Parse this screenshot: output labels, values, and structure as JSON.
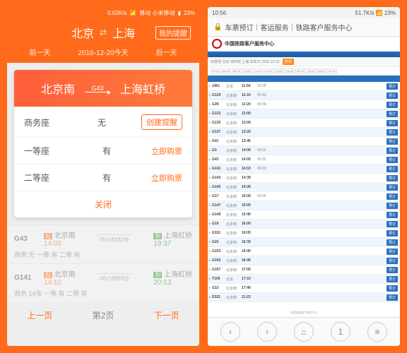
{
  "left": {
    "status": {
      "speed": "0.02K/s",
      "carrier": "移动  小米移动",
      "battery": "23%"
    },
    "header": {
      "from": "北京",
      "to": "上海",
      "remind": "我的提醒",
      "prev": "前一天",
      "date": "2016-12-20今天",
      "next": "后一天"
    },
    "modal": {
      "from": "北京南",
      "train": "G43",
      "to": "上海虹桥",
      "seats": [
        {
          "name": "商务座",
          "status": "无",
          "action": "创建提醒",
          "boxed": true
        },
        {
          "name": "一等座",
          "status": "有",
          "action": "立即购票",
          "boxed": false
        },
        {
          "name": "二等座",
          "status": "有",
          "action": "立即购票",
          "boxed": false
        }
      ],
      "close": "关闭"
    },
    "list": [
      {
        "no": "G43",
        "from": "北京南",
        "to": "上海虹桥",
        "dur": "05小时32分",
        "dep": "14:05",
        "arr": "19:37",
        "sum": "商务:无  一等:有  二等:有"
      },
      {
        "no": "G141",
        "from": "北京南",
        "to": "上海虹桥",
        "dur": "06小时03分",
        "dep": "14:10",
        "arr": "20:13",
        "sum": "商务:14张  一等:有  二等:有"
      }
    ],
    "pager": {
      "prev": "上一页",
      "cur": "第2页",
      "next": "下一页"
    },
    "tags": {
      "dep": "起",
      "arr": "到"
    }
  },
  "right": {
    "status": {
      "time": "10:56",
      "speed": "51.7K/s",
      "battery": "23%"
    },
    "url": "车票预订｜客运服务｜铁路客户服务中心",
    "brand": "中国铁路客户服务中心",
    "search": {
      "label": "出发地 北京  目的地 上海  出发日 2016-12-20",
      "btn": "查询"
    },
    "filter_chips": [
      "00:00",
      "06:00",
      "08:00",
      "10:00",
      "11:00",
      "12:00",
      "13:00",
      "15:00",
      "16:00",
      "18:00",
      "20:00",
      "22:00"
    ],
    "rows": [
      {
        "no": "1461",
        "st": "北京",
        "t1": "11:54",
        "dur": "19:28"
      },
      {
        "no": "G129",
        "st": "北京南",
        "t1": "12:10",
        "dur": "05:43"
      },
      {
        "no": "G39",
        "st": "北京南",
        "t1": "12:20",
        "dur": "05:58"
      },
      {
        "no": "G133",
        "st": "北京南",
        "t1": "13:00",
        "dur": ""
      },
      {
        "no": "G135",
        "st": "北京南",
        "t1": "13:05",
        "dur": ""
      },
      {
        "no": "G137",
        "st": "北京南",
        "t1": "13:20",
        "dur": ""
      },
      {
        "no": "G41",
        "st": "北京南",
        "t1": "13:45",
        "dur": ""
      },
      {
        "no": "G3",
        "st": "北京南",
        "t1": "14:00",
        "dur": "04:55"
      },
      {
        "no": "G43",
        "st": "北京南",
        "t1": "14:05",
        "dur": "05:32"
      },
      {
        "no": "G141",
        "st": "北京南",
        "t1": "14:10",
        "dur": "06:03"
      },
      {
        "no": "G143",
        "st": "北京南",
        "t1": "14:30",
        "dur": ""
      },
      {
        "no": "G145",
        "st": "北京南",
        "t1": "14:35",
        "dur": ""
      },
      {
        "no": "G17",
        "st": "北京南",
        "t1": "15:00",
        "dur": "04:55"
      },
      {
        "no": "G147",
        "st": "北京南",
        "t1": "15:05",
        "dur": ""
      },
      {
        "no": "G149",
        "st": "北京南",
        "t1": "15:40",
        "dur": ""
      },
      {
        "no": "G19",
        "st": "北京南",
        "t1": "16:00",
        "dur": ""
      },
      {
        "no": "G151",
        "st": "北京南",
        "t1": "16:05",
        "dur": ""
      },
      {
        "no": "G23",
        "st": "北京南",
        "t1": "16:30",
        "dur": ""
      },
      {
        "no": "G153",
        "st": "北京南",
        "t1": "16:40",
        "dur": ""
      },
      {
        "no": "G155",
        "st": "北京南",
        "t1": "16:45",
        "dur": ""
      },
      {
        "no": "G157",
        "st": "北京南",
        "t1": "17:05",
        "dur": ""
      },
      {
        "no": "T109",
        "st": "北京",
        "t1": "17:10",
        "dur": ""
      },
      {
        "no": "G13",
        "st": "北京南",
        "t1": "17:40",
        "dur": ""
      },
      {
        "no": "D321",
        "st": "北京南",
        "t1": "21:23",
        "dur": ""
      }
    ],
    "book": "预订",
    "footer": "中国铁路客户服务中心",
    "page": "1"
  }
}
